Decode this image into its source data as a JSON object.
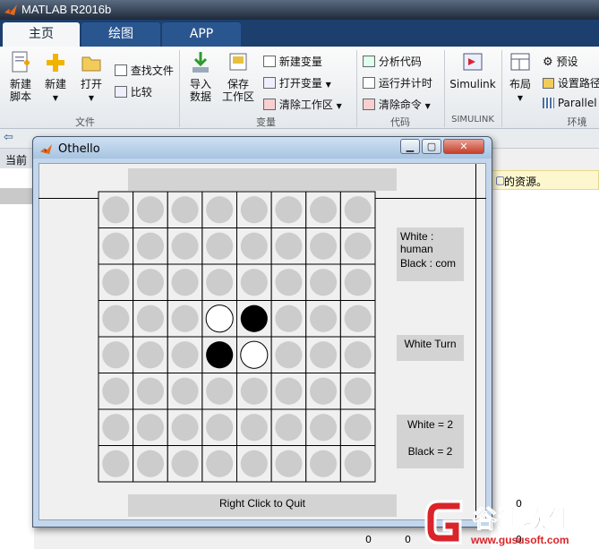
{
  "matlab": {
    "title": "MATLAB R2016b",
    "tabs": [
      {
        "label": "主页",
        "active": true
      },
      {
        "label": "绘图",
        "active": false
      },
      {
        "label": "APP",
        "active": false
      }
    ],
    "ribbon": {
      "new_script": [
        "新建",
        "脚本"
      ],
      "new": "新建",
      "open": "打开",
      "find_files": "查找文件",
      "compare": "比较",
      "group_file": "文件",
      "import_data": [
        "导入",
        "数据"
      ],
      "save_workspace": [
        "保存",
        "工作区"
      ],
      "new_variable": "新建变量",
      "open_variable": "打开变量",
      "clear_workspace": "清除工作区",
      "group_variable": "变量",
      "analyze_code": "分析代码",
      "run_and_time": "运行并计时",
      "clear_commands": "清除命令",
      "group_code": "代码",
      "simulink": "Simulink",
      "group_simulink": "SIMULINK",
      "layout": "布局",
      "preferences": "预设",
      "set_path": "设置路径",
      "parallel": "Parallel",
      "group_env": "环境"
    },
    "current_folder_label": "当前文",
    "message_fragment": "的资源。",
    "pane_numbers": [
      "0",
      "0",
      "0",
      "0"
    ]
  },
  "othello": {
    "window_title": "Othello",
    "player_info": {
      "white": "White : human",
      "black": "Black : com"
    },
    "turn": "White Turn",
    "score": {
      "white": "White = 2",
      "black": "Black = 2"
    },
    "quit": "Right Click to Quit",
    "board_size": 8,
    "pieces": [
      {
        "row": 3,
        "col": 3,
        "color": "white"
      },
      {
        "row": 3,
        "col": 4,
        "color": "black"
      },
      {
        "row": 4,
        "col": 3,
        "color": "black"
      },
      {
        "row": 4,
        "col": 4,
        "color": "white"
      }
    ]
  },
  "watermark": {
    "brand": "谷速软件",
    "url": "www.gususoft.com"
  },
  "colors": {
    "ribbon_tab_bar": "#1c3f6e",
    "empty_cell": "#cccccc",
    "panel": "#d3d3d3",
    "watermark_red": "#d9252a"
  }
}
